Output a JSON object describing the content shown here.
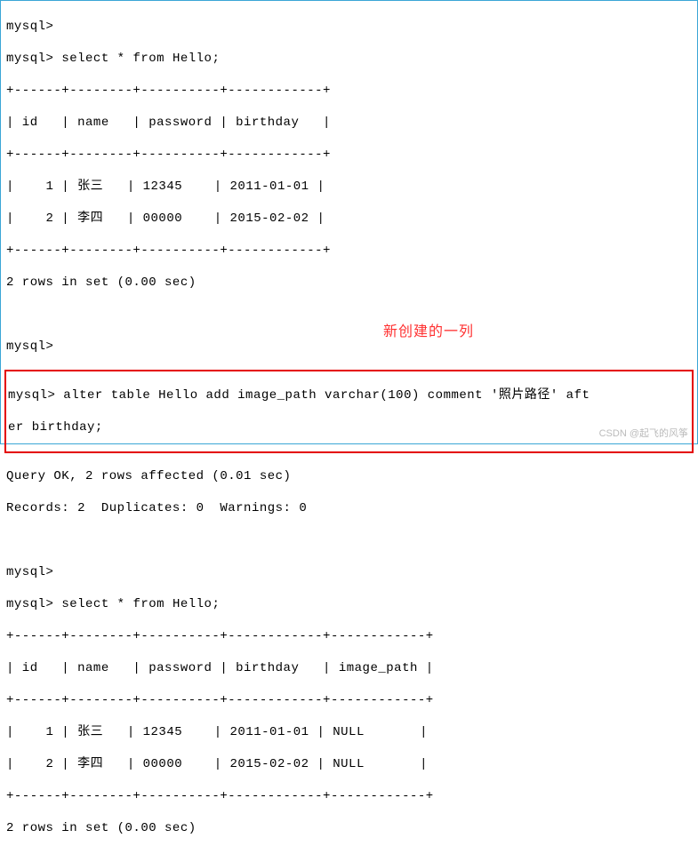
{
  "prompt": "mysql>",
  "cmd1": "select * from Hello;",
  "table1": {
    "border_top": "+------+--------+----------+------------+",
    "header": "| id   | name   | password | birthday   |",
    "border_mid": "+------+--------+----------+------------+",
    "rows": [
      "|    1 | 张三   | 12345    | 2011-01-01 |",
      "|    2 | 李四   | 00000    | 2015-02-02 |"
    ],
    "border_bot": "+------+--------+----------+------------+",
    "summary": "2 rows in set (0.00 sec)"
  },
  "alter_cmd_line1": "mysql> alter table Hello add image_path varchar(100) comment '照片路径' aft",
  "alter_cmd_line2": "er birthday;",
  "alter_result1": "Query OK, 2 rows affected (0.01 sec)",
  "alter_result2": "Records: 2  Duplicates: 0  Warnings: 0",
  "cmd2": "select * from Hello;",
  "annotation": "新创建的一列",
  "table2": {
    "border_top": "+------+--------+----------+------------+------------+",
    "header": "| id   | name   | password | birthday   | image_path |",
    "border_mid": "+------+--------+----------+------------+------------+",
    "rows": [
      "|    1 | 张三   | 12345    | 2011-01-01 | NULL       |",
      "|    2 | 李四   | 00000    | 2015-02-02 | NULL       |"
    ],
    "border_bot": "+------+--------+----------+------------+------------+",
    "summary": "2 rows in set (0.00 sec)"
  },
  "watermark": "CSDN @起飞的风筝"
}
